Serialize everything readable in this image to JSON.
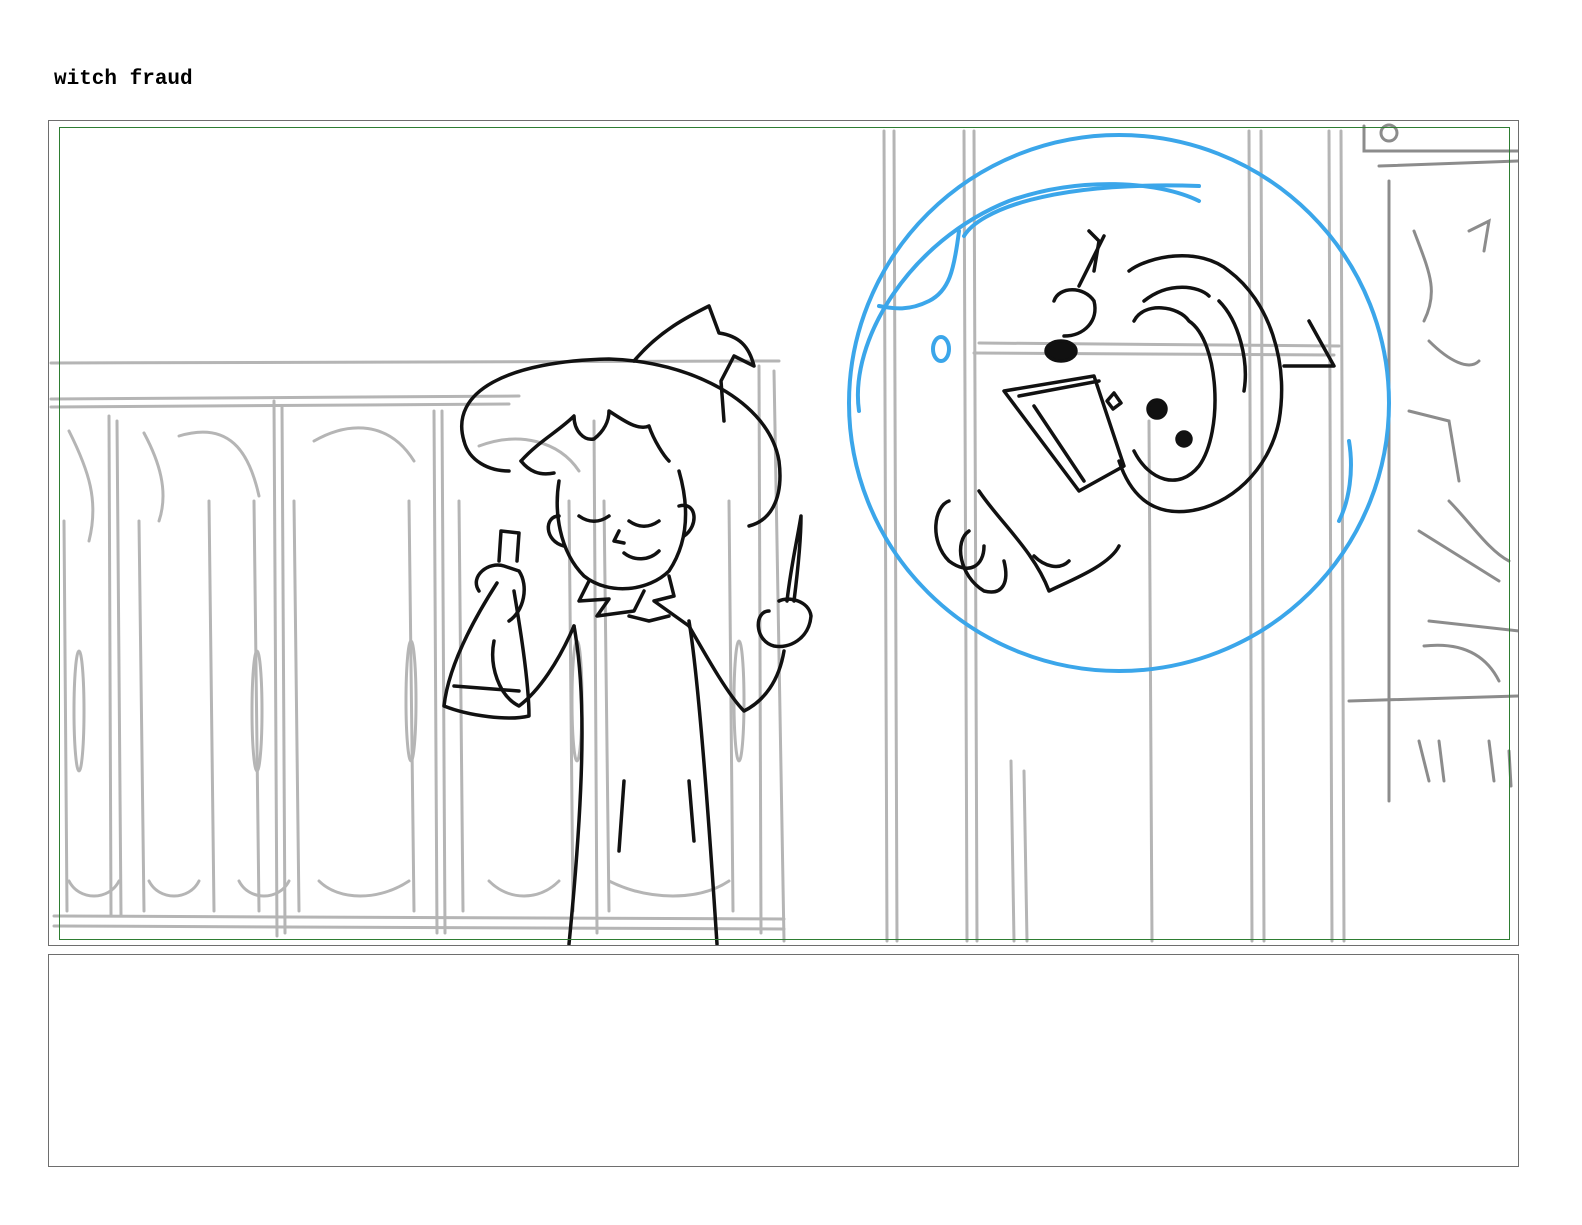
{
  "page": {
    "title": "witch fraud"
  },
  "panel": {
    "description_icons": [
      "witch-character",
      "bubble",
      "child-in-bubble",
      "lockers-background"
    ],
    "colors": {
      "frame": "#6e6e6e",
      "safe_area": "#2e7d32",
      "bubble": "#3ba6ea",
      "background_lines": "#b5b5b5",
      "ink": "#111111"
    }
  },
  "notes": {
    "text": ""
  }
}
